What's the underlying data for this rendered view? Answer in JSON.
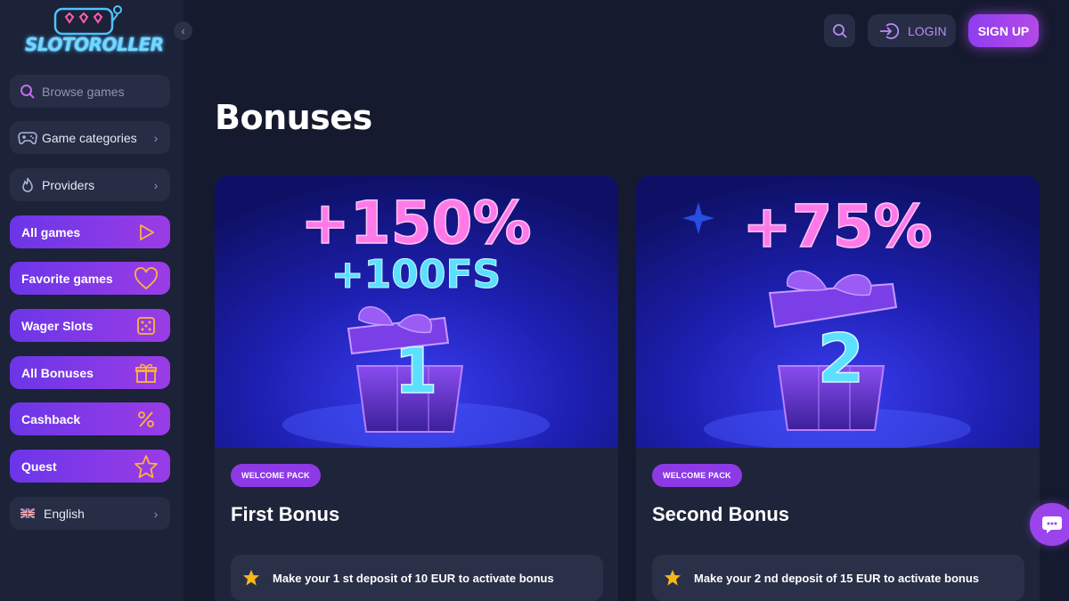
{
  "brand": {
    "name": "SLOTOROLLER"
  },
  "sidebar": {
    "search_placeholder": "Browse games",
    "items": [
      {
        "label": "Game categories",
        "icon": "gamepad-icon"
      },
      {
        "label": "Providers",
        "icon": "flame-icon"
      },
      {
        "label": "All games",
        "icon": "play-icon"
      },
      {
        "label": "Favorite games",
        "icon": "heart-icon"
      },
      {
        "label": "Wager Slots",
        "icon": "dice-icon"
      },
      {
        "label": "All Bonuses",
        "icon": "gift-icon"
      },
      {
        "label": "Cashback",
        "icon": "percent-icon"
      },
      {
        "label": "Quest",
        "icon": "star-icon"
      }
    ],
    "language": {
      "label": "English",
      "icon": "uk-flag-icon"
    }
  },
  "header": {
    "login_label": "LOGIN",
    "signup_label": "SIGN UP"
  },
  "main": {
    "title": "Bonuses",
    "cards": [
      {
        "image_text_1": "+150%",
        "image_text_2": "+100FS",
        "image_number": "1",
        "badge": "WELCOME PACK",
        "title": "First Bonus",
        "condition": "Make your 1 st deposit of 10 EUR to activate bonus"
      },
      {
        "image_text_1": "+75%",
        "image_number": "2",
        "badge": "WELCOME PACK",
        "title": "Second Bonus",
        "condition": "Make your 2 nd deposit of 15 EUR to activate bonus"
      }
    ]
  },
  "colors": {
    "background": "#151a2e",
    "sidebar": "#1c2237",
    "accent_purple": "#8d3ae6",
    "star_gold": "#f5b81a"
  }
}
